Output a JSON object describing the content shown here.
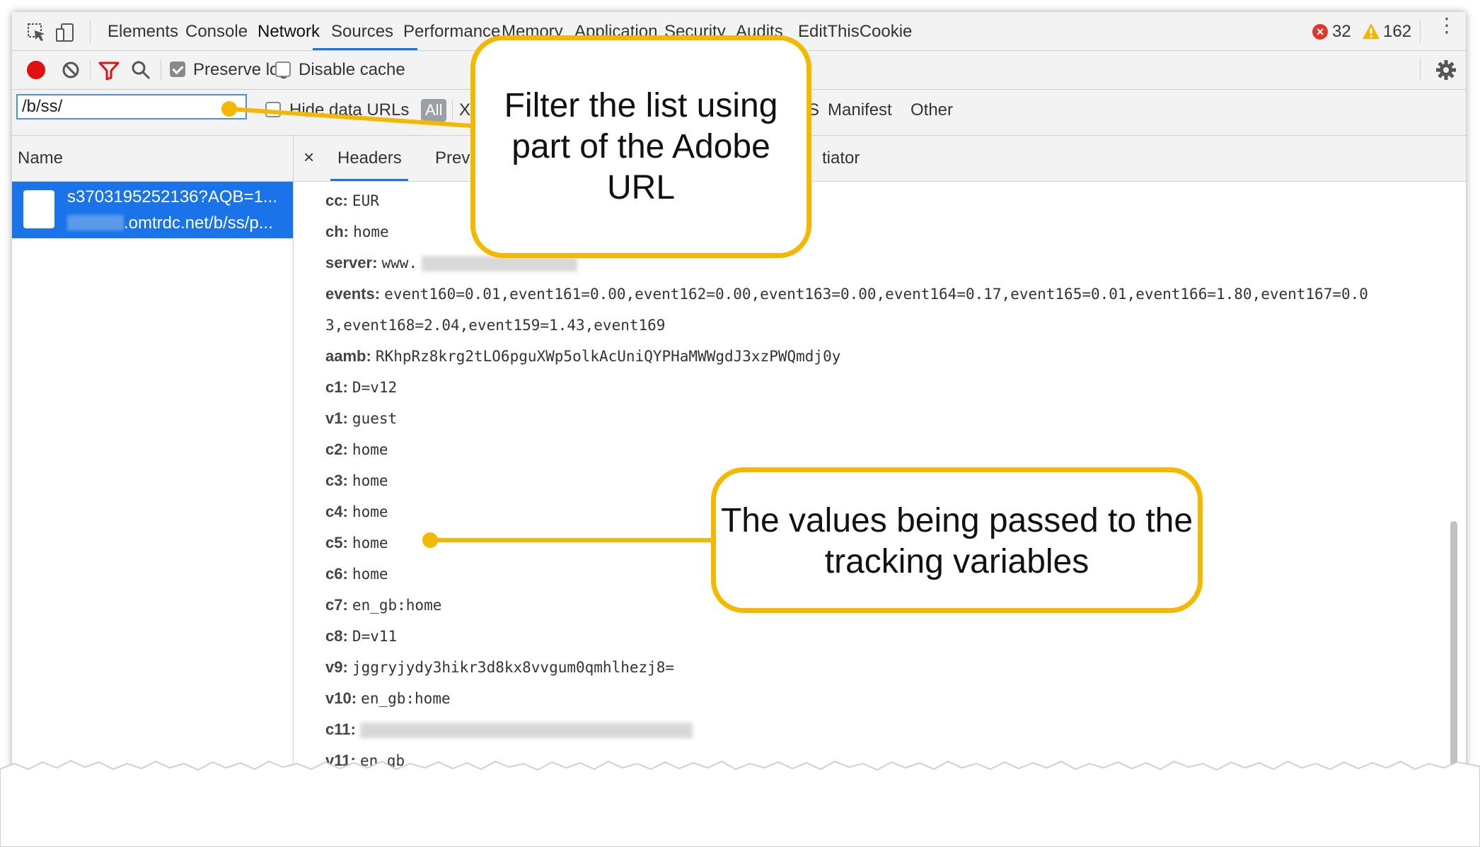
{
  "tabbar": {
    "tabs": [
      "Elements",
      "Console",
      "Network",
      "Sources",
      "Performance",
      "Memory",
      "Application",
      "Security",
      "Audits",
      "EditThisCookie"
    ],
    "active": "Network",
    "errors": "32",
    "warnings": "162"
  },
  "toolbar": {
    "preserve_log": "Preserve log",
    "disable_cache": "Disable cache"
  },
  "filterbar": {
    "filter_value": "/b/ss/",
    "hide_data_urls": "Hide data URLs",
    "all": "All",
    "x_fragment": "X",
    "s_fragment": "S",
    "manifest": "Manifest",
    "other": "Other"
  },
  "requests": {
    "column": "Name",
    "items": [
      {
        "name": "s3703195252136?AQB=1...",
        "domain": ".omtrdc.net/b/ss/p..."
      }
    ]
  },
  "detail_tabs": {
    "close": "×",
    "headers": "Headers",
    "preview": "Prev",
    "initiator": "tiator"
  },
  "params": [
    {
      "key": "cc:",
      "value": "EUR"
    },
    {
      "key": "ch:",
      "value": "home"
    },
    {
      "key": "server:",
      "value": "www."
    },
    {
      "key": "events:",
      "value": "event160=0.01,event161=0.00,event162=0.00,event163=0.00,event164=0.17,event165=0.01,event166=1.80,event167=0.0"
    },
    {
      "key": "",
      "value": "3,event168=2.04,event159=1.43,event169"
    },
    {
      "key": "aamb:",
      "value": "RKhpRz8krg2tLO6pguXWp5olkAcUniQYPHaMWWgdJ3xzPWQmdj0y"
    },
    {
      "key": "c1:",
      "value": "D=v12"
    },
    {
      "key": "v1:",
      "value": "guest"
    },
    {
      "key": "c2:",
      "value": "home"
    },
    {
      "key": "c3:",
      "value": "home"
    },
    {
      "key": "c4:",
      "value": "home"
    },
    {
      "key": "c5:",
      "value": "home"
    },
    {
      "key": "c6:",
      "value": "home"
    },
    {
      "key": "c7:",
      "value": "en_gb:home"
    },
    {
      "key": "c8:",
      "value": "D=v11"
    },
    {
      "key": "v9:",
      "value": "jggryjydy3hikr3d8kx8vvgum0qmhlhezj8="
    },
    {
      "key": "v10:",
      "value": "en_gb:home"
    },
    {
      "key": "c11:",
      "value": ""
    },
    {
      "key": "v11:",
      "value": "en_gb"
    }
  ],
  "callouts": {
    "filter_text": "Filter the list using part of the Adobe URL",
    "values_text": "The values being passed to the tracking variables"
  },
  "colors": {
    "accent": "#1a73e8",
    "callout": "#f5b800",
    "record": "#e0120f"
  },
  "icons": [
    "inspect-icon",
    "device-toggle-icon",
    "record-icon",
    "clear-icon",
    "filter-icon",
    "search-icon",
    "gear-icon",
    "error-icon",
    "warning-icon",
    "kebab-icon",
    "file-icon",
    "close-icon"
  ]
}
